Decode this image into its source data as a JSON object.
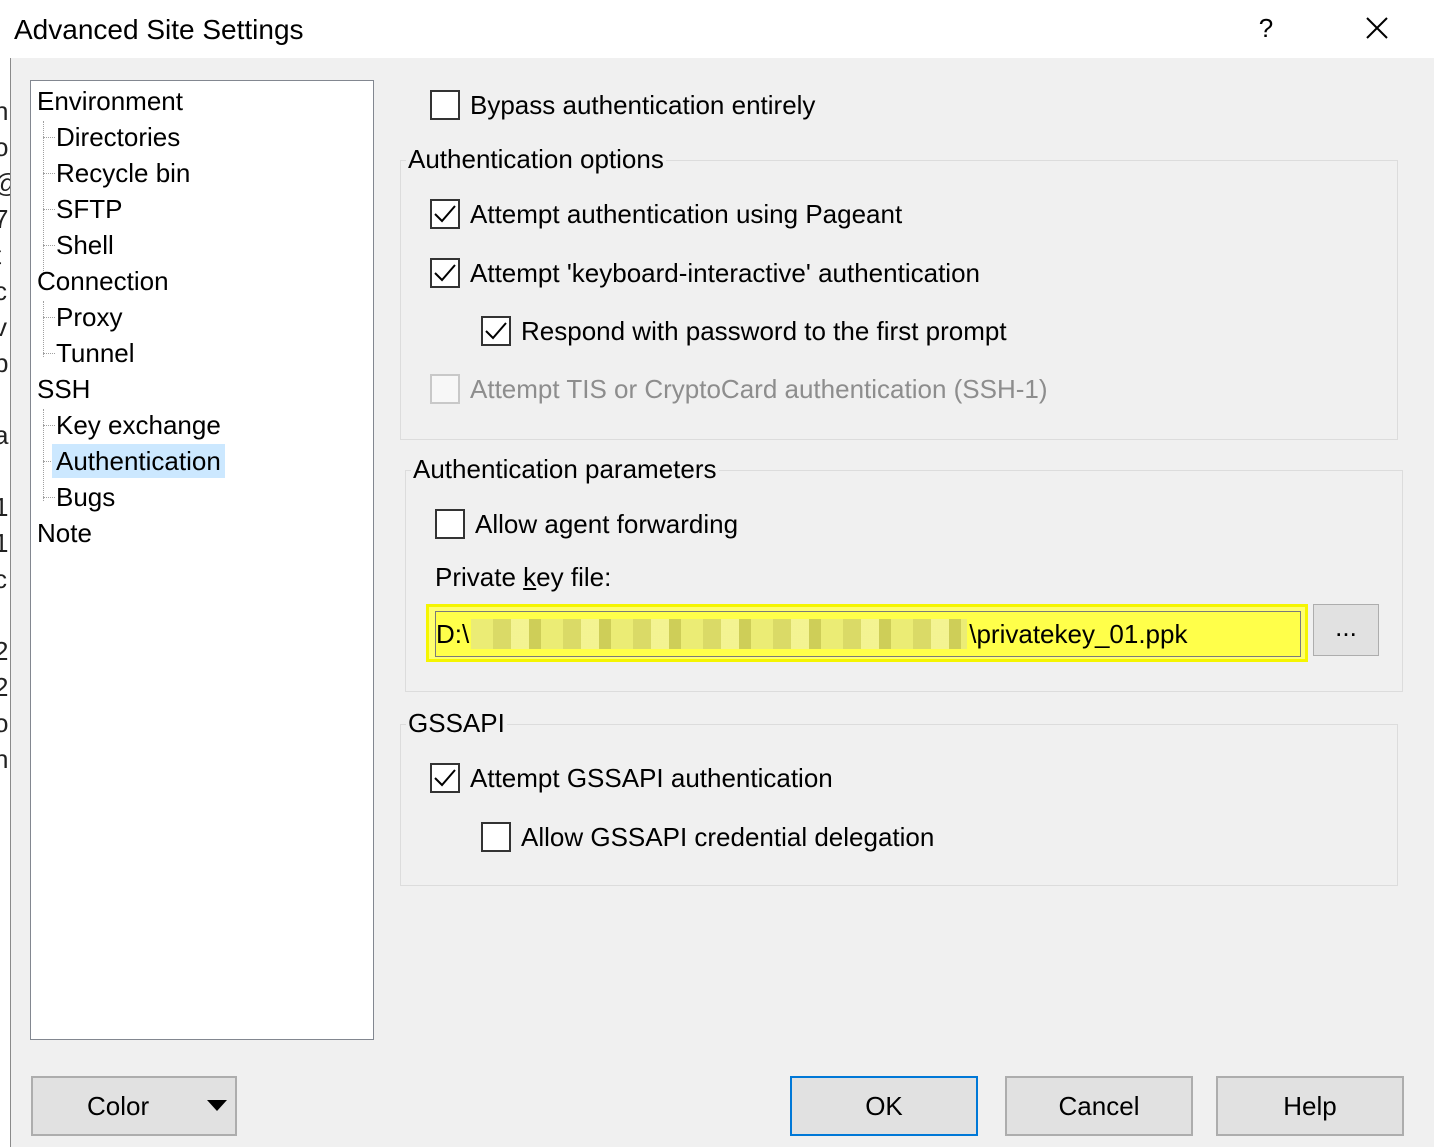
{
  "window": {
    "title": "Advanced Site Settings",
    "help_glyph": "?",
    "close_icon": "close-icon"
  },
  "tree": {
    "items": [
      {
        "label": "Environment",
        "level": 0
      },
      {
        "label": "Directories",
        "level": 1
      },
      {
        "label": "Recycle bin",
        "level": 1
      },
      {
        "label": "SFTP",
        "level": 1
      },
      {
        "label": "Shell",
        "level": 1
      },
      {
        "label": "Connection",
        "level": 0
      },
      {
        "label": "Proxy",
        "level": 1
      },
      {
        "label": "Tunnel",
        "level": 1
      },
      {
        "label": "SSH",
        "level": 0
      },
      {
        "label": "Key exchange",
        "level": 1
      },
      {
        "label": "Authentication",
        "level": 1,
        "selected": true
      },
      {
        "label": "Bugs",
        "level": 1
      },
      {
        "label": "Note",
        "level": 0
      }
    ]
  },
  "auth": {
    "bypass": {
      "label": "Bypass authentication entirely",
      "checked": false
    },
    "options_group": "Authentication options",
    "pageant": {
      "label": "Attempt authentication using Pageant",
      "checked": true
    },
    "keyboard_interactive": {
      "label": "Attempt 'keyboard-interactive' authentication",
      "checked": true
    },
    "respond_password": {
      "label": "Respond with password to the first prompt",
      "checked": true
    },
    "tis": {
      "label": "Attempt TIS or CryptoCard authentication (SSH-1)",
      "checked": false,
      "disabled": true
    },
    "params_group": "Authentication parameters",
    "agent_forwarding": {
      "label": "Allow agent forwarding",
      "checked": false
    },
    "private_key_label_pre": "Private ",
    "private_key_label_accel": "k",
    "private_key_label_post": "ey file:",
    "private_key_prefix": "D:\\",
    "private_key_suffix": "\\privatekey_01.ppk",
    "browse_label": "...",
    "gssapi_group": "GSSAPI",
    "gssapi_attempt": {
      "label": "Attempt GSSAPI authentication",
      "checked": true
    },
    "gssapi_delegation": {
      "label": "Allow GSSAPI credential delegation",
      "checked": false
    }
  },
  "buttons": {
    "color": "Color",
    "ok": "OK",
    "cancel": "Cancel",
    "help": "Help"
  },
  "colors": {
    "highlight": "#ffff4a",
    "selection": "#cce8ff",
    "default_button_border": "#0078d7"
  }
}
